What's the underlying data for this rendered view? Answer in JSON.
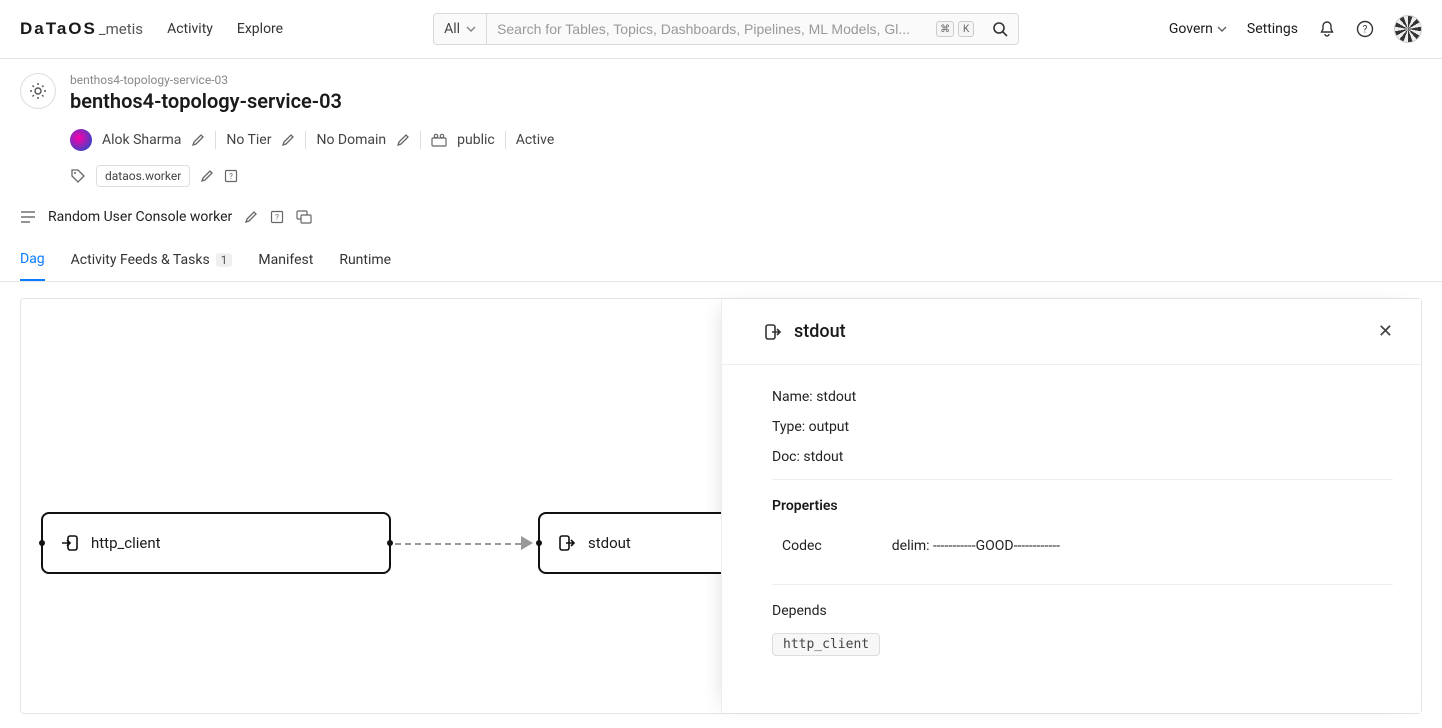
{
  "brand": {
    "logo": "DaTaOS",
    "product": "_metis"
  },
  "nav": {
    "activity": "Activity",
    "explore": "Explore"
  },
  "search": {
    "all_label": "All",
    "placeholder": "Search for Tables, Topics, Dashboards, Pipelines, ML Models, Gl...",
    "kbd1": "⌘",
    "kbd2": "K"
  },
  "right_nav": {
    "govern": "Govern",
    "settings": "Settings"
  },
  "entity": {
    "breadcrumb": "benthos4-topology-service-03",
    "title": "benthos4-topology-service-03",
    "owner": "Alok Sharma",
    "tier": "No Tier",
    "domain": "No Domain",
    "workspace": "public",
    "status": "Active",
    "tag": "dataos.worker",
    "description": "Random User Console worker"
  },
  "tabs": {
    "dag": "Dag",
    "feeds": "Activity Feeds & Tasks",
    "feeds_count": "1",
    "manifest": "Manifest",
    "runtime": "Runtime"
  },
  "dag": {
    "node1": "http_client",
    "node2": "stdout"
  },
  "panel": {
    "title": "stdout",
    "name_label": "Name:",
    "name_value": "stdout",
    "type_label": "Type:",
    "type_value": "output",
    "doc_label": "Doc:",
    "doc_value": "stdout",
    "properties_label": "Properties",
    "prop_key": "Codec",
    "prop_val": "delim: -----------GOOD------------",
    "depends_label": "Depends",
    "depends_value": "http_client"
  }
}
